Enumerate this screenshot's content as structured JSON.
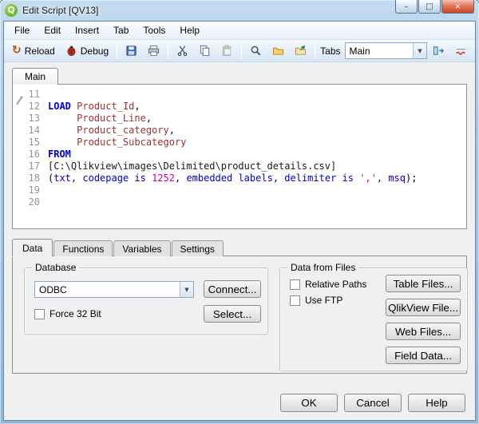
{
  "window": {
    "title": "Edit Script [QV13]"
  },
  "icons": {
    "qlikview": "Q",
    "minimize": "–",
    "maximize": "□",
    "close": "×",
    "reload": "↻",
    "combo_arrow": "▼"
  },
  "colors": {
    "frame_blue": "#8fb6da",
    "toolbar_blue": "#e2edf8",
    "qlik_green": "#55a314"
  },
  "menu": {
    "items": [
      "File",
      "Edit",
      "Insert",
      "Tab",
      "Tools",
      "Help"
    ]
  },
  "toolbar": {
    "reload_label": "Reload",
    "debug_label": "Debug",
    "tabs_label": "Tabs",
    "tabs_value": "Main",
    "icon_names": [
      "reload",
      "debug",
      "save",
      "print",
      "cut",
      "copy",
      "paste",
      "find",
      "open-folder",
      "include-file",
      "move-tab",
      "syntax-check"
    ]
  },
  "editor": {
    "tab_label": "Main",
    "syntax_colors": {
      "kw": "#0000cc",
      "kw2": "#0000cc",
      "field": "#993333",
      "path": "#1a1a1a",
      "str": "#cc0099",
      "num": "#cc0099",
      "plain": "#000000"
    },
    "lines": [
      {
        "num": "11",
        "segments": []
      },
      {
        "num": "12",
        "segments": [
          {
            "t": "LOAD",
            "c": "kw"
          },
          {
            "t": " ",
            "c": "plain"
          },
          {
            "t": "Product_Id",
            "c": "field"
          },
          {
            "t": ",",
            "c": "plain"
          }
        ]
      },
      {
        "num": "13",
        "segments": [
          {
            "t": "     ",
            "c": "plain"
          },
          {
            "t": "Product_Line",
            "c": "field"
          },
          {
            "t": ",",
            "c": "plain"
          }
        ]
      },
      {
        "num": "14",
        "segments": [
          {
            "t": "     ",
            "c": "plain"
          },
          {
            "t": "Product_category",
            "c": "field"
          },
          {
            "t": ",",
            "c": "plain"
          }
        ]
      },
      {
        "num": "15",
        "segments": [
          {
            "t": "     ",
            "c": "plain"
          },
          {
            "t": "Product_Subcategory",
            "c": "field"
          }
        ]
      },
      {
        "num": "16",
        "segments": [
          {
            "t": "FROM",
            "c": "kw"
          }
        ]
      },
      {
        "num": "17",
        "segments": [
          {
            "t": "[C:\\Qlikview\\images\\Delimited\\product_details.csv]",
            "c": "path"
          }
        ]
      },
      {
        "num": "18",
        "segments": [
          {
            "t": "(",
            "c": "plain"
          },
          {
            "t": "txt",
            "c": "kw2"
          },
          {
            "t": ", ",
            "c": "plain"
          },
          {
            "t": "codepage is ",
            "c": "kw2"
          },
          {
            "t": "1252",
            "c": "num"
          },
          {
            "t": ", ",
            "c": "plain"
          },
          {
            "t": "embedded labels",
            "c": "kw2"
          },
          {
            "t": ", ",
            "c": "plain"
          },
          {
            "t": "delimiter is ",
            "c": "kw2"
          },
          {
            "t": "','",
            "c": "str"
          },
          {
            "t": ", ",
            "c": "plain"
          },
          {
            "t": "msq",
            "c": "kw2"
          },
          {
            "t": ");",
            "c": "plain"
          }
        ]
      },
      {
        "num": "19",
        "segments": []
      },
      {
        "num": "20",
        "segments": []
      }
    ]
  },
  "panel": {
    "tabs": [
      "Data",
      "Functions",
      "Variables",
      "Settings"
    ],
    "active_tab": "Data",
    "database": {
      "group_label": "Database",
      "combo_value": "ODBC",
      "connect_button": "Connect...",
      "select_button": "Select...",
      "force32_label": "Force 32 Bit",
      "force32_checked": false
    },
    "files": {
      "group_label": "Data from Files",
      "relative_paths_label": "Relative Paths",
      "relative_paths_checked": false,
      "use_ftp_label": "Use FTP",
      "use_ftp_checked": false,
      "buttons": [
        "Table Files...",
        "QlikView File...",
        "Web Files...",
        "Field Data..."
      ]
    }
  },
  "footer": {
    "ok": "OK",
    "cancel": "Cancel",
    "help": "Help"
  }
}
